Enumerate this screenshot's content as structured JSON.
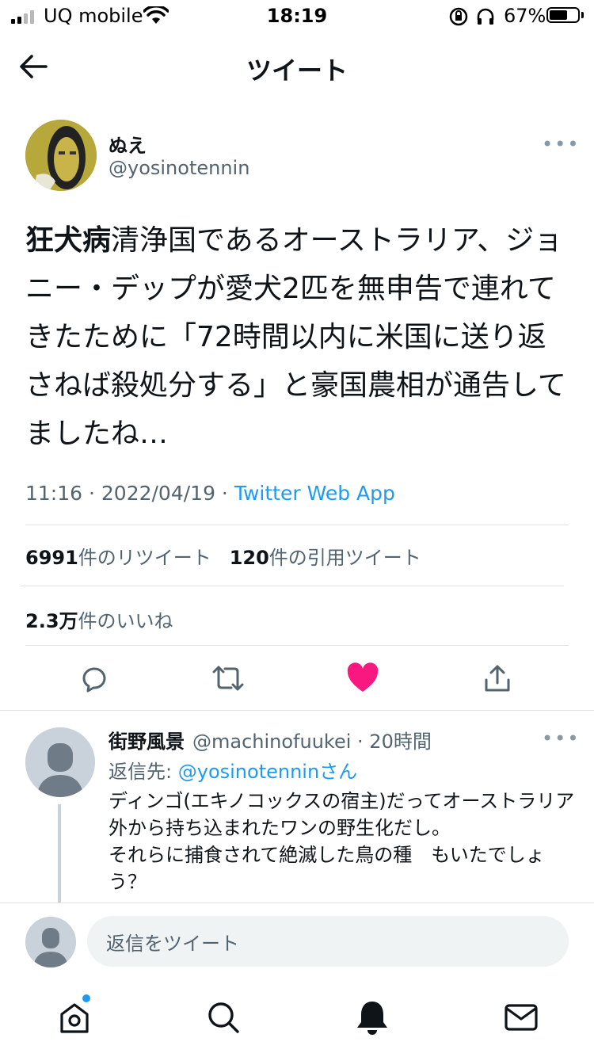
{
  "status_bar": {
    "carrier": "UQ mobile",
    "time": "18:19",
    "battery": "67%"
  },
  "header": {
    "title": "ツイート"
  },
  "tweet": {
    "author_name": "ぬえ",
    "author_handle": "@yosinotennin",
    "text_bold": "狂犬病",
    "text_rest": "清浄国であるオーストラリア、ジョニー・デップが愛犬2匹を無申告で連れてきたために「72時間以内に米国に送り返さねば殺処分する」と豪国農相が通告してましたね…",
    "time": "11:16",
    "date": "2022/04/19",
    "source": "Twitter Web App",
    "retweets_count": "6991",
    "retweets_label": "件のリツイート",
    "quotes_count": "120",
    "quotes_label": "件の引用ツイート",
    "likes_count": "2.3万",
    "likes_label": "件のいいね"
  },
  "reply": {
    "name": "街野風景",
    "handle": "@machinofuukei",
    "time": "20時間",
    "replying_label": "返信先:",
    "replying_handle": "@yosinotenninさん",
    "text": "ディンゴ(エキノコックスの宿主)だってオーストラリア外から持ち込まれたワンの野生化だし。\nそれらに捕食されて絶滅した鳥の種　もいたでしょう？"
  },
  "compose": {
    "placeholder": "返信をツイート"
  },
  "colors": {
    "accent": "#1d9bf0",
    "like": "#f91880",
    "muted": "#536471"
  },
  "icons": {
    "back": "arrow-left-icon",
    "reply": "reply-icon",
    "retweet": "retweet-icon",
    "like": "heart-filled-icon",
    "share": "share-icon",
    "home": "home-icon",
    "search": "search-icon",
    "notifications": "bell-icon",
    "messages": "mail-icon"
  }
}
